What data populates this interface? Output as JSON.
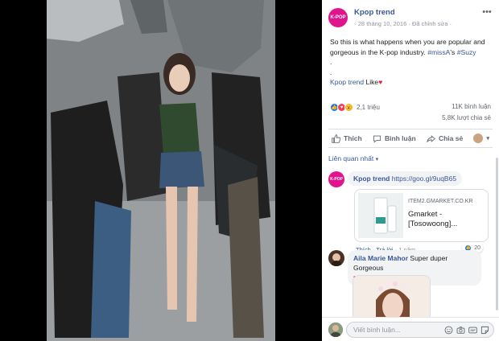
{
  "page": {
    "name": "Kpop trend",
    "avatar_text": "K-POP"
  },
  "post": {
    "date": "28 tháng 10, 2016",
    "location_label": "Đã chỉnh sửa",
    "text_line1": "So this is what happens when you are popular and gorgeous in the K-pop industry. ",
    "hashtag1": "#missA",
    "text_mid": "'s ",
    "hashtag2": "#Suzy",
    "dot": ".",
    "dot2": ".",
    "liker": "Kpop trend",
    "like_word": "Like",
    "reactions_count": "2,1 triệu",
    "comments_count": "11K bình luận",
    "shares_count": "5,8K lượt chia sẻ"
  },
  "actions": {
    "like": "Thích",
    "comment": "Bình luận",
    "share": "Chia sẻ"
  },
  "comments_filter": "Liên quan nhất",
  "comment1": {
    "author": "Kpop trend",
    "link": "https://goo.gl/9uqB65",
    "card_domain": "ITEM2.GMARKET.CO.KR",
    "card_title": "Gmarket - [Tosowoong]...",
    "like": "Thích",
    "reply": "Trả lời",
    "time": "1 năm",
    "likes": "20"
  },
  "comment2": {
    "author": "Aila Marie Mahor",
    "text": "Super duper Gorgeous"
  },
  "composer": {
    "placeholder": "Viết bình luận..."
  },
  "colors": {
    "link": "#385898",
    "brand": "#e0148c",
    "like": "#1877f2",
    "love": "#f33e58"
  }
}
